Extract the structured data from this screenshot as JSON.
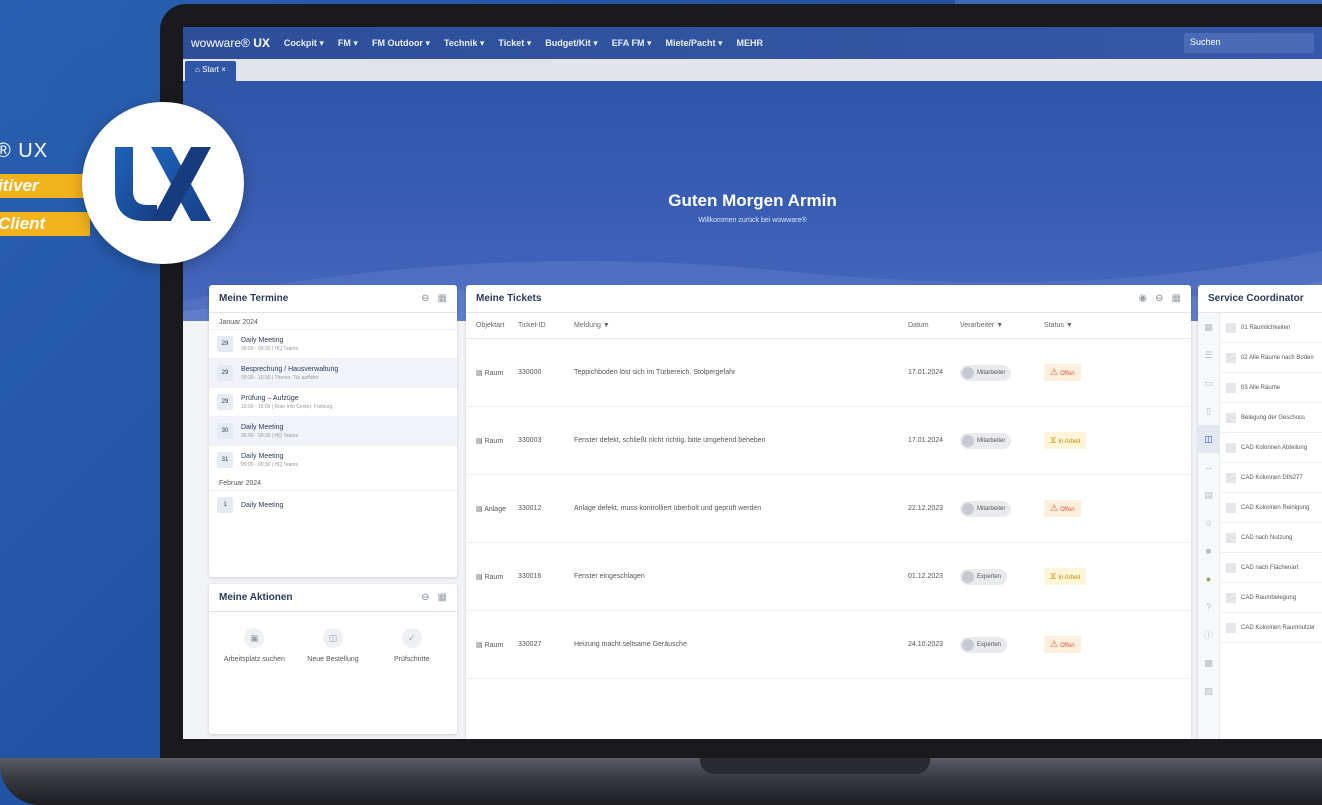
{
  "promo": {
    "ux_label": "® UX",
    "tag1": "itiver",
    "tag2": "Client"
  },
  "app": {
    "brand": "wowware®",
    "brand_ux": "UX",
    "nav": [
      "Cockpit",
      "FM",
      "FM Outdoor",
      "Technik",
      "Ticket",
      "Budget/Kit",
      "EFA FM",
      "Miete/Pacht"
    ],
    "nav_more": "MEHR",
    "search_placeholder": "Suchen",
    "tab": "Start"
  },
  "hero": {
    "title": "Guten Morgen Armin",
    "subtitle": "Willkommen zurück bei wowware®"
  },
  "termine": {
    "title": "Meine Termine",
    "months": [
      {
        "name": "Januar 2024",
        "items": [
          {
            "day": "29",
            "title": "Daily Meeting",
            "sub": "09:00 - 09:30 | HQ Teams",
            "hl": false
          },
          {
            "day": "29",
            "title": "Besprechung / Hausverwaltung",
            "sub": "09:30 - 10:30 | Thema: Tür auffahrt",
            "hl": true
          },
          {
            "day": "29",
            "title": "Prüfung – Aufzüge",
            "sub": "10:00 - 16:00 | Rote Info Center, Freiburg",
            "hl": false
          },
          {
            "day": "30",
            "title": "Daily Meeting",
            "sub": "09:00 - 09:30 | HQ Teams",
            "hl": true
          },
          {
            "day": "31",
            "title": "Daily Meeting",
            "sub": "09:00 - 09:30 | HQ Teams",
            "hl": false
          }
        ]
      },
      {
        "name": "Februar 2024",
        "items": [
          {
            "day": "1",
            "title": "Daily Meeting",
            "sub": "",
            "hl": false
          }
        ]
      }
    ]
  },
  "aktionen": {
    "title": "Meine Aktionen",
    "items": [
      {
        "label": "Arbeitsplatz suchen",
        "icon": "monitor-icon"
      },
      {
        "label": "Neue Bestellung",
        "icon": "cart-icon"
      },
      {
        "label": "Prüfschritte",
        "icon": "check-icon"
      }
    ]
  },
  "tickets": {
    "title": "Meine Tickets",
    "columns": [
      "Objektart",
      "Ticket-ID",
      "Meldung",
      "Datum",
      "Verarbeiter",
      "Status"
    ],
    "rows": [
      {
        "type": "Raum",
        "id": "330000",
        "msg": "Teppichboden löst sich im Türbereich. Stolpergefahr",
        "date": "17.01.2024",
        "assignee": "Mitarbeiter",
        "status": "Offen",
        "status_kind": "open"
      },
      {
        "type": "Raum",
        "id": "330003",
        "msg": "Fenster defekt, schließt nicht richtig, bitte umgehend beheben",
        "date": "17.01.2024",
        "assignee": "Mitarbeiter",
        "status": "In Arbeit",
        "status_kind": "prog"
      },
      {
        "type": "Anlage",
        "id": "330012",
        "msg": "Anlage defekt, muss kontrolliert überholt und geprüft werden",
        "date": "22.12.2023",
        "assignee": "Mitarbeiter",
        "status": "Offen",
        "status_kind": "open"
      },
      {
        "type": "Raum",
        "id": "330016",
        "msg": "Fenster eingeschlagen",
        "date": "01.12.2023",
        "assignee": "Experten",
        "status": "In Arbeit",
        "status_kind": "prog"
      },
      {
        "type": "Raum",
        "id": "330027",
        "msg": "Heizung macht seltsame Geräusche",
        "date": "24.10.2023",
        "assignee": "Experten",
        "status": "Offen",
        "status_kind": "open"
      }
    ]
  },
  "service": {
    "title": "Service Coordinator",
    "items": [
      "01 Räumlichkeiten",
      "02 Alle Räume nach Boden",
      "03 Alle Räume",
      "Belegung der Geschoss",
      "CAD Kolonnen Abteilung",
      "CAD Kolonnen DIN277",
      "CAD Kolonnen Reinigung",
      "CAD nach Nutzung",
      "CAD nach Flächenart",
      "CAD Raumbelegung",
      "CAD Kolonnen Raumnutzer"
    ]
  }
}
